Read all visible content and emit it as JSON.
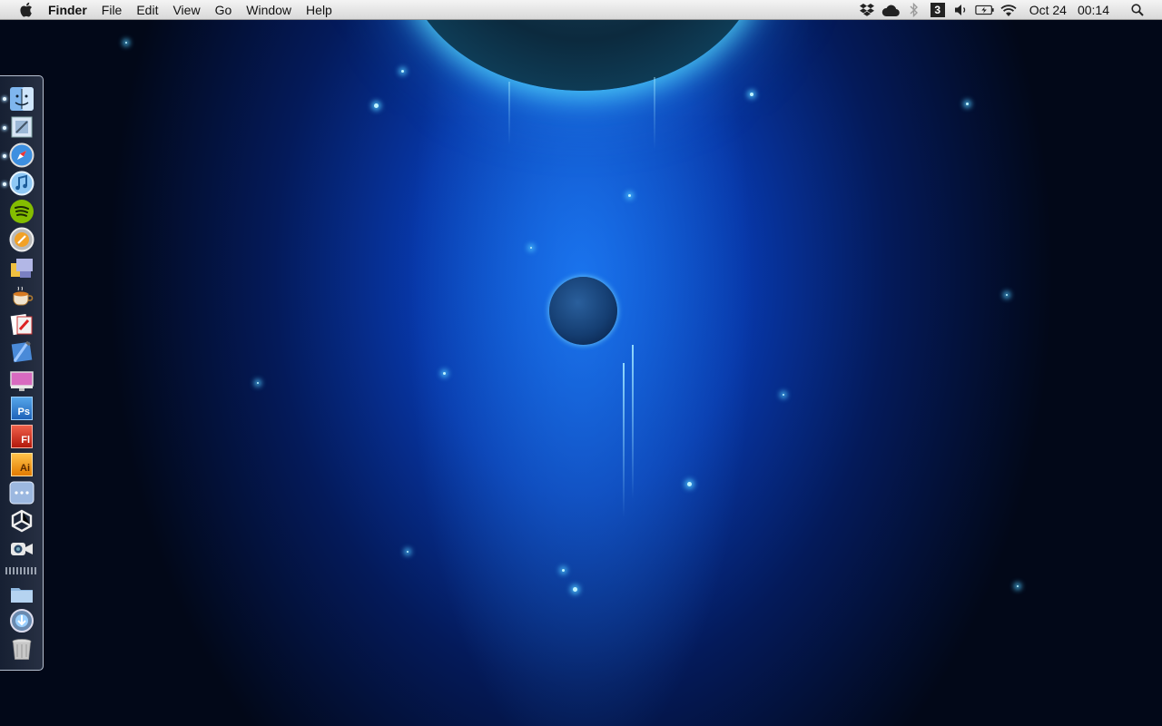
{
  "menubar": {
    "apple_icon": "apple-icon",
    "app_name": "Finder",
    "menus": [
      "File",
      "Edit",
      "View",
      "Go",
      "Window",
      "Help"
    ],
    "tray": {
      "icons": [
        "dropbox-icon",
        "icloud-icon",
        "bluetooth-icon",
        "calendar-badge-icon",
        "volume-icon",
        "battery-icon",
        "wifi-icon"
      ],
      "calendar_badge": "3",
      "date": "Oct 24",
      "time": "00:14",
      "spotlight_icon": "spotlight-icon"
    }
  },
  "dock": {
    "items": [
      {
        "name": "finder",
        "running": true
      },
      {
        "name": "mail",
        "running": true
      },
      {
        "name": "safari",
        "running": true
      },
      {
        "name": "itunes",
        "running": true
      },
      {
        "name": "spotify",
        "running": false
      },
      {
        "name": "reeder",
        "running": false
      },
      {
        "name": "transmit",
        "running": false
      },
      {
        "name": "coffee-cup",
        "running": false
      },
      {
        "name": "css-edit",
        "running": false
      },
      {
        "name": "xcode",
        "running": false
      },
      {
        "name": "imac-display",
        "running": false
      },
      {
        "name": "photoshop",
        "running": false,
        "label": "Ps"
      },
      {
        "name": "flash",
        "running": false,
        "label": "Fl"
      },
      {
        "name": "illustrator",
        "running": false,
        "label": "Ai"
      },
      {
        "name": "more-apps",
        "running": false
      },
      {
        "name": "unity",
        "running": false
      },
      {
        "name": "facetime",
        "running": false
      }
    ],
    "stack_items": [
      {
        "name": "documents-folder"
      },
      {
        "name": "downloads-stack"
      },
      {
        "name": "trash"
      }
    ]
  },
  "colors": {
    "menubar": "#e6e6e6",
    "desktop_glow": "#0a57d8",
    "desktop_dark": "#020818",
    "planet_rim": "#31d9ff"
  }
}
